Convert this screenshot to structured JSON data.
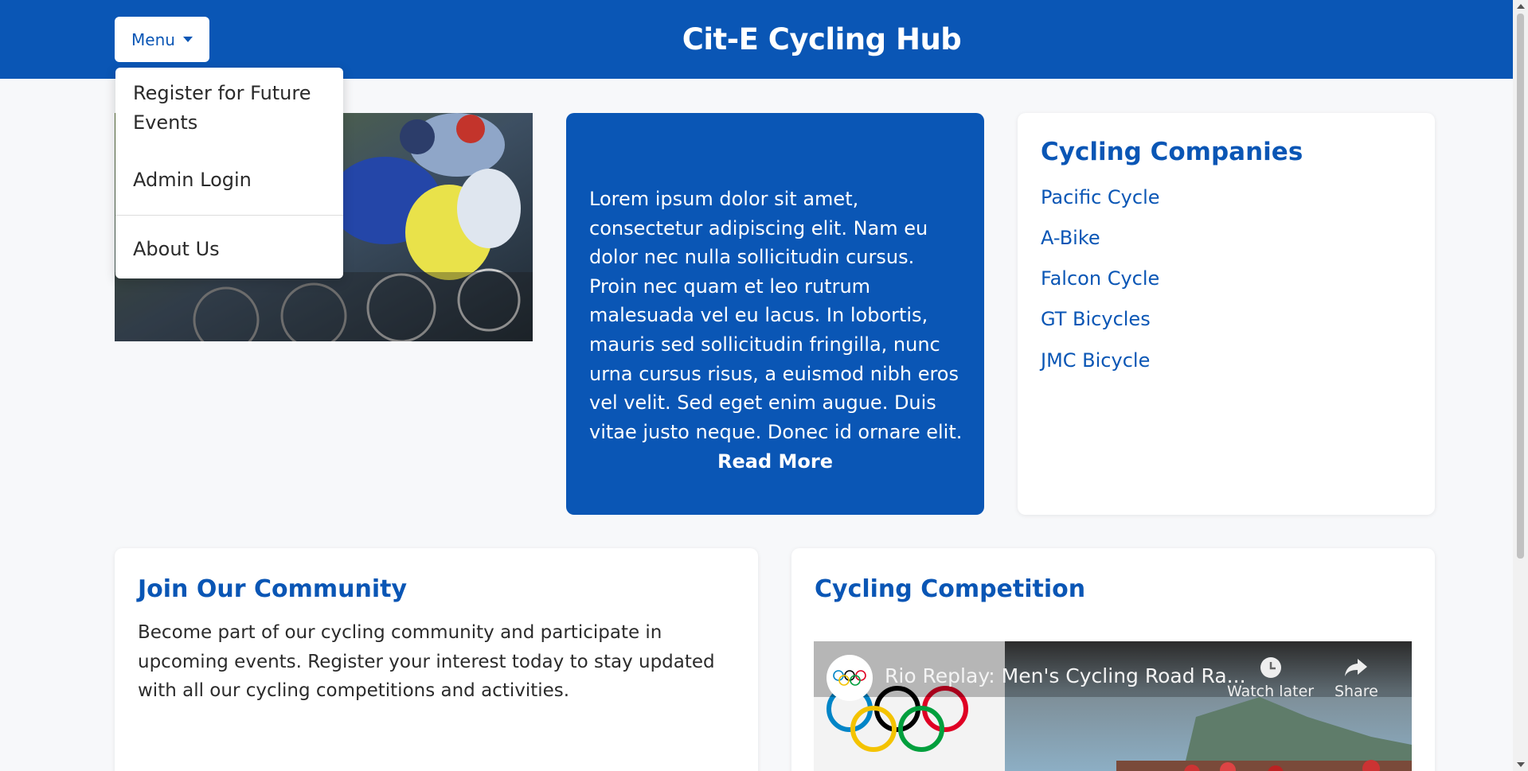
{
  "header": {
    "title": "Cit-E Cycling Hub",
    "menu_label": "Menu"
  },
  "dropdown": {
    "items": [
      "Register for Future Events",
      "Admin Login",
      "About Us"
    ]
  },
  "hero_image": {
    "icon": "cycling-race-photo"
  },
  "intro_card": {
    "text": "Lorem ipsum dolor sit amet, consectetur adipiscing elit. Nam eu dolor nec nulla sollicitudin cursus. Proin nec quam et leo rutrum malesuada vel eu lacus. In lobortis, mauris sed sollicitudin fringilla, nunc urna cursus risus, a euismod nibh eros vel velit. Sed eget enim augue. Duis vitae justo neque. Donec id ornare elit.",
    "read_more": "Read More"
  },
  "companies": {
    "title": "Cycling Companies",
    "links": [
      "Pacific Cycle",
      "A-Bike",
      "Falcon Cycle",
      "GT Bicycles",
      "JMC Bicycle"
    ]
  },
  "community": {
    "title": "Join Our Community",
    "text": "Become part of our cycling community and participate in upcoming events. Register your interest today to stay updated with all our cycling competitions and activities."
  },
  "competition": {
    "title": "Cycling Competition",
    "video": {
      "title": "Rio Replay: Men's Cycling Road Ra...",
      "watch_later": "Watch later",
      "share": "Share"
    }
  },
  "colors": {
    "brand_blue": "#0a56b5",
    "page_bg": "#f7f8fa"
  }
}
